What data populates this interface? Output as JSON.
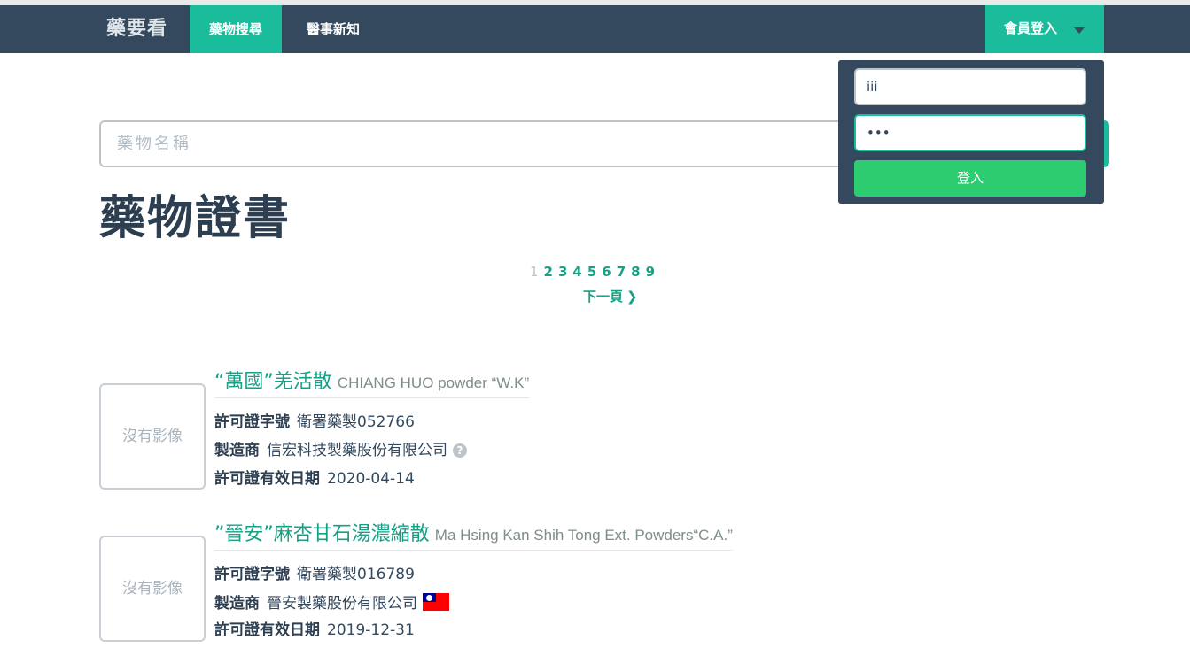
{
  "navbar": {
    "brand": "藥要看",
    "items": [
      {
        "label": "藥物搜尋",
        "active": true
      },
      {
        "label": "醫事新知",
        "active": false
      }
    ],
    "login_label": "會員登入"
  },
  "search": {
    "placeholder": "藥物名稱"
  },
  "page_title": "藥物證書",
  "pagination": {
    "current": "1",
    "pages": [
      "2",
      "3",
      "4",
      "5",
      "6",
      "7",
      "8",
      "9"
    ],
    "next_label": "下一頁"
  },
  "labels": {
    "license_no": "許可證字號",
    "manufacturer": "製造商",
    "expiry": "許可證有效日期",
    "no_image": "沒有影像"
  },
  "results": [
    {
      "name_zh": "“萬國”羌活散",
      "name_en": "CHIANG HUO powder “W.K”",
      "license_no": "衛署藥製052766",
      "manufacturer": "信宏科技製藥股份有限公司",
      "expiry": "2020-04-14",
      "manufacturer_icon": "help-icon"
    },
    {
      "name_zh": "”晉安”麻杏甘石湯濃縮散",
      "name_en": "Ma Hsing Kan Shih Tong Ext. Powders“C.A.”",
      "license_no": "衛署藥製016789",
      "manufacturer": "晉安製藥股份有限公司",
      "expiry": "2019-12-31",
      "manufacturer_icon": "taiwan-flag-icon"
    }
  ],
  "login_dropdown": {
    "username": "iii",
    "password": "•••",
    "submit_label": "登入"
  },
  "colors": {
    "navbar": "#34495e",
    "accent": "#1abc9c",
    "link": "#16a085",
    "submit": "#2ecc71"
  }
}
